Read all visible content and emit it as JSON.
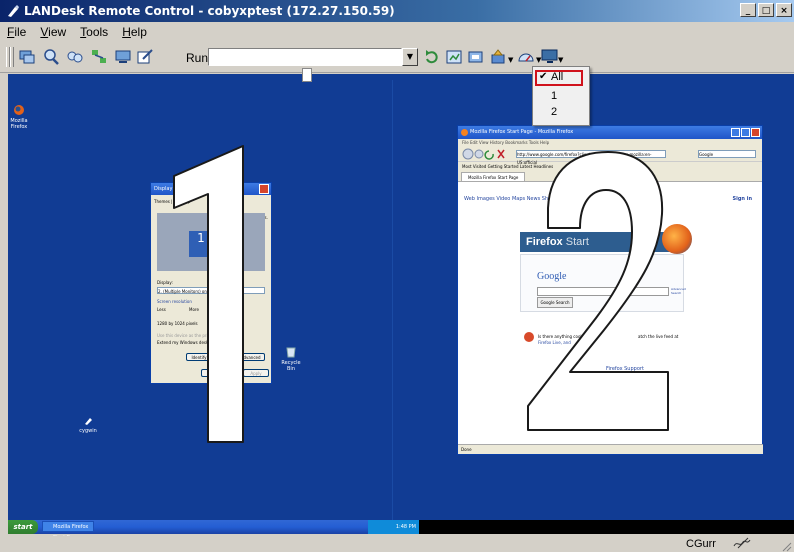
{
  "window": {
    "title": "LANDesk Remote Control - cobyxptest  (172.27.150.59)",
    "controls": [
      "_",
      "□",
      "×"
    ]
  },
  "menubar": {
    "items": [
      {
        "label": "File",
        "underline": "F",
        "rest": "ile"
      },
      {
        "label": "View",
        "underline": "V",
        "rest": "iew"
      },
      {
        "label": "Tools",
        "underline": "T",
        "rest": "ools"
      },
      {
        "label": "Help",
        "underline": "H",
        "rest": "elp"
      }
    ]
  },
  "toolbar": {
    "run_label": "Run:",
    "run_value": "",
    "icons": [
      "connect-icon",
      "zoom-icon",
      "chat-icon",
      "network-icon",
      "desktop-icon",
      "draw-icon",
      "refresh-icon",
      "fit-icon",
      "screenshot-icon",
      "settings-icon",
      "speed-icon",
      "monitor-icon"
    ]
  },
  "monitor_dropdown": {
    "items": [
      {
        "label": "All",
        "checked": true
      },
      {
        "label": "1",
        "checked": false
      },
      {
        "label": "2",
        "checked": false
      }
    ],
    "highlight_color": "#d0121c"
  },
  "remote_desktop": {
    "background_color": "#113c94",
    "monitor_labels": [
      "1",
      "2"
    ],
    "desktop_icons": [
      {
        "name": "Mozilla Firefox"
      },
      {
        "name": "Recycle Bin"
      },
      {
        "name": "cygwin"
      }
    ],
    "display_dialog": {
      "title": "Display Properties",
      "tabs": "Themes | Desktop",
      "side_text": "our monitors.",
      "monitor_number": "1",
      "display_label": "Display:",
      "display_value": "2. (Multiple Monitors) on ATI Mobili",
      "resolution_label": "Screen resolution",
      "less": "Less",
      "more": "More",
      "resolution_value": "1280 by 1024 pixels",
      "primary_text": "Use this device as the primary m",
      "extend_text": "Extend my Windows desktop on",
      "identify_btn": "Identify",
      "advanced_btn": "dvanced",
      "ok_btn": "OK",
      "apply_btn": "Apply"
    },
    "firefox": {
      "title": "Mozilla Firefox Start Page - Mozilla Firefox",
      "menus": "File   Edit   View   History   Bookmarks   Tools   Help",
      "url": "http://www.google.com/firefox?client=firefox-a&rls=org.mozilla:en-US:official",
      "search_placeholder": "Google",
      "bookmarks": "Most Visited    Getting Started    Latest Headlines",
      "tab_label": "Mozilla Firefox Start Page",
      "links": "Web   Images   Video   Maps   News   Shopping",
      "signin": "Sign in",
      "band_text": "Firefox",
      "band_sub": "Start",
      "google_logo": "Google",
      "search_button": "Google Search",
      "advanced": "Advanced Search",
      "note_line1": "Is there anything cooler",
      "note_line2": "Firefox Live, and",
      "note_line3": "atch the live feed at",
      "help": "Firefox Support",
      "status": "Done"
    },
    "taskbar": {
      "start_label": "start",
      "task_item": "Mozilla Firefox Start P...",
      "clock": "1:48 PM"
    }
  },
  "statusbar": {
    "user": "CGurr"
  }
}
